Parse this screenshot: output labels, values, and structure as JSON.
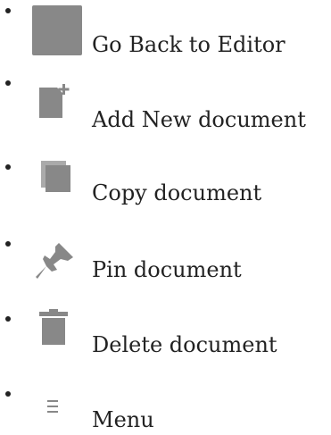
{
  "menu": {
    "items": [
      {
        "label": "Go Back to Editor",
        "icon": "editor-icon"
      },
      {
        "label": "Add New document",
        "icon": "add-document-icon"
      },
      {
        "label": "Copy document",
        "icon": "copy-document-icon"
      },
      {
        "label": "Pin document",
        "icon": "pin-icon"
      },
      {
        "label": "Delete document",
        "icon": "trash-icon"
      },
      {
        "label": "Menu",
        "icon": "hamburger-menu-icon"
      }
    ]
  },
  "colors": {
    "icon": "#888888",
    "text": "#222222",
    "background": "#ffffff"
  }
}
